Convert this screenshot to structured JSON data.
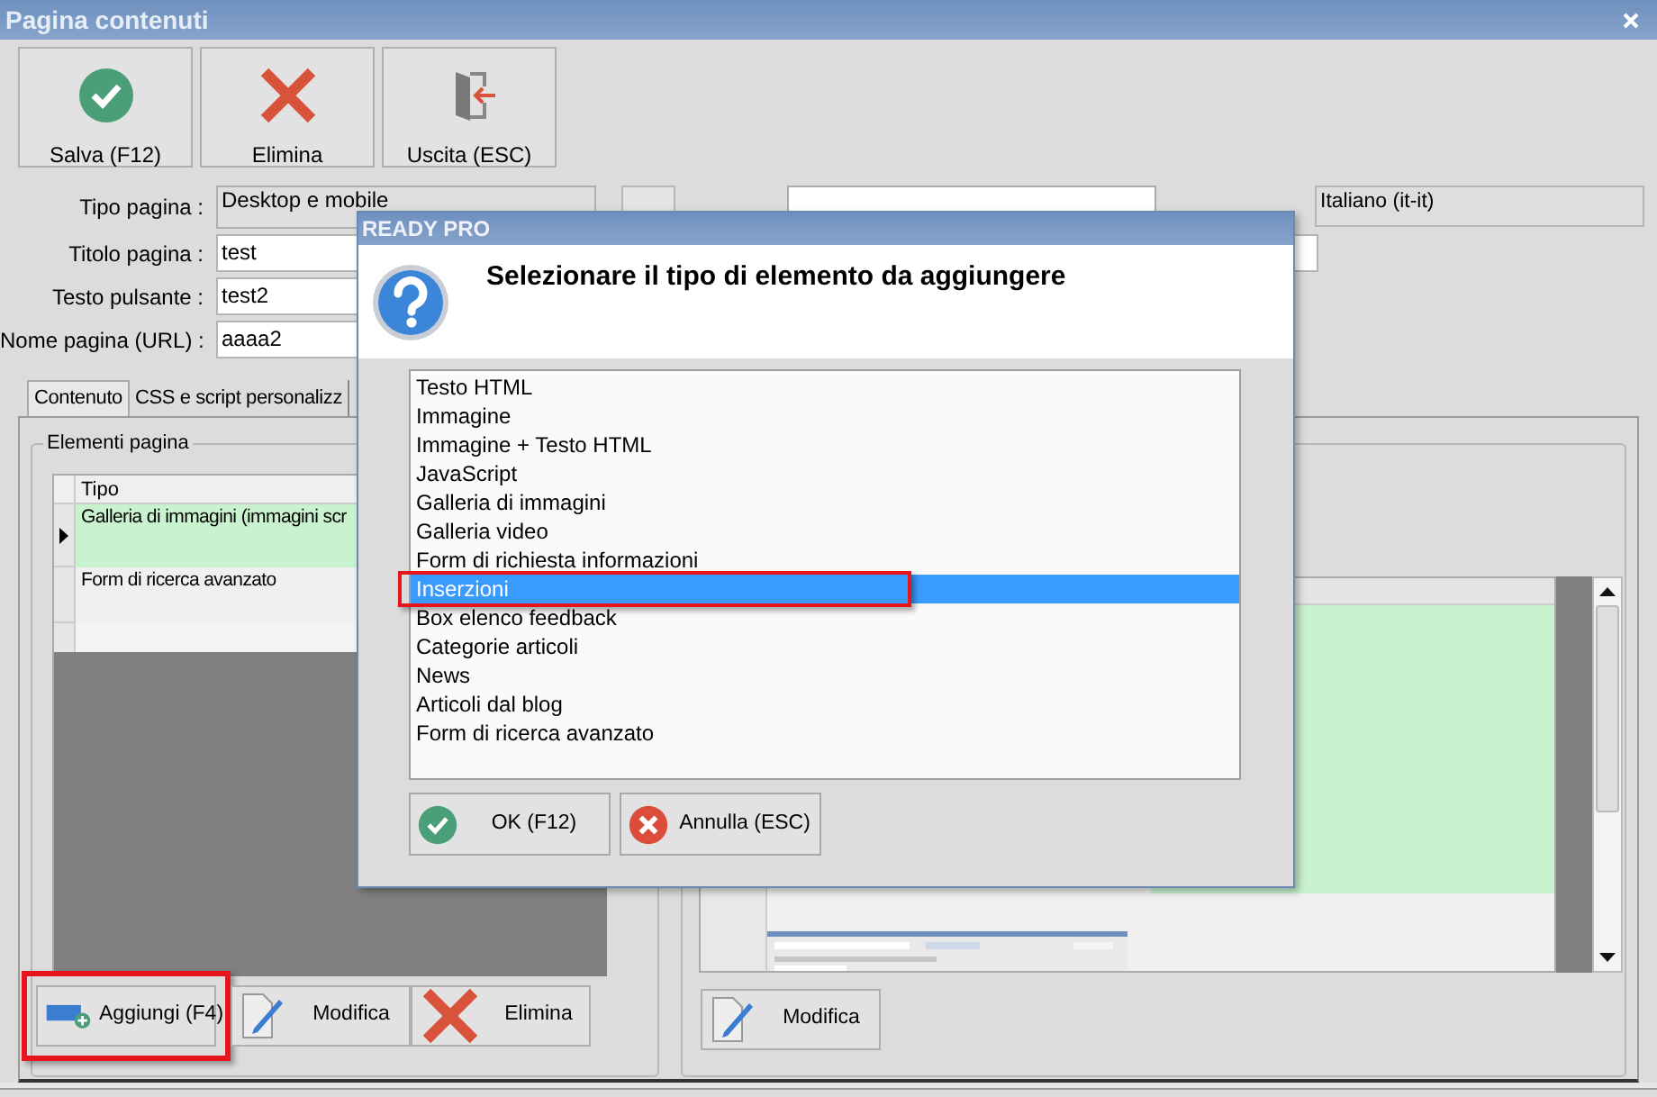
{
  "window": {
    "title": "Pagina contenuti"
  },
  "toolbar": [
    {
      "label": "Salva (F12)",
      "kind": "save"
    },
    {
      "label": "Elimina",
      "kind": "delete"
    },
    {
      "label": "Uscita (ESC)",
      "kind": "exit"
    }
  ],
  "form": [
    {
      "label": "Tipo pagina :",
      "value": "Desktop e mobile",
      "readonly": true
    },
    {
      "label": "Titolo pagina :",
      "value": "test",
      "readonly": false
    },
    {
      "label": "Testo pulsante :",
      "value": "test2",
      "readonly": false
    },
    {
      "label": "Nome pagina (URL) :",
      "value": "aaaa2",
      "readonly": false
    }
  ],
  "language_field": {
    "value": "Italiano (it-it)"
  },
  "tabs": [
    {
      "label": "Contenuto",
      "selected": true
    },
    {
      "label": "CSS e script personalizz",
      "selected": false
    }
  ],
  "elements_group": {
    "title": "Elementi pagina",
    "column": "Tipo",
    "rows": [
      {
        "label": "Galleria di immagini (immagini scr",
        "selected": true
      },
      {
        "label": "Form di ricerca avanzato",
        "selected": false
      }
    ],
    "buttons": [
      {
        "label": "Aggiungi (F4)",
        "kind": "add",
        "highlighted": true
      },
      {
        "label": "Modifica",
        "kind": "edit",
        "highlighted": false
      },
      {
        "label": "Elimina",
        "kind": "delete",
        "highlighted": false
      }
    ]
  },
  "preview_group": {
    "buttons": [
      {
        "label": "Modifica",
        "kind": "edit"
      }
    ]
  },
  "dialog": {
    "title": "READY PRO",
    "heading": "Selezionare il tipo di elemento da aggiungere",
    "items": [
      {
        "label": "Testo HTML",
        "selected": false
      },
      {
        "label": "Immagine",
        "selected": false
      },
      {
        "label": "Immagine + Testo HTML",
        "selected": false
      },
      {
        "label": "JavaScript",
        "selected": false
      },
      {
        "label": "Galleria di immagini",
        "selected": false
      },
      {
        "label": "Galleria video",
        "selected": false
      },
      {
        "label": "Form di richiesta informazioni",
        "selected": false
      },
      {
        "label": "Inserzioni",
        "selected": true
      },
      {
        "label": "Box elenco feedback",
        "selected": false
      },
      {
        "label": "Categorie articoli",
        "selected": false
      },
      {
        "label": "News",
        "selected": false
      },
      {
        "label": "Articoli dal blog",
        "selected": false
      },
      {
        "label": "Form di ricerca avanzato",
        "selected": false
      }
    ],
    "buttons": [
      {
        "label": "OK (F12)",
        "kind": "ok"
      },
      {
        "label": "Annulla (ESC)",
        "kind": "cancel"
      }
    ]
  }
}
